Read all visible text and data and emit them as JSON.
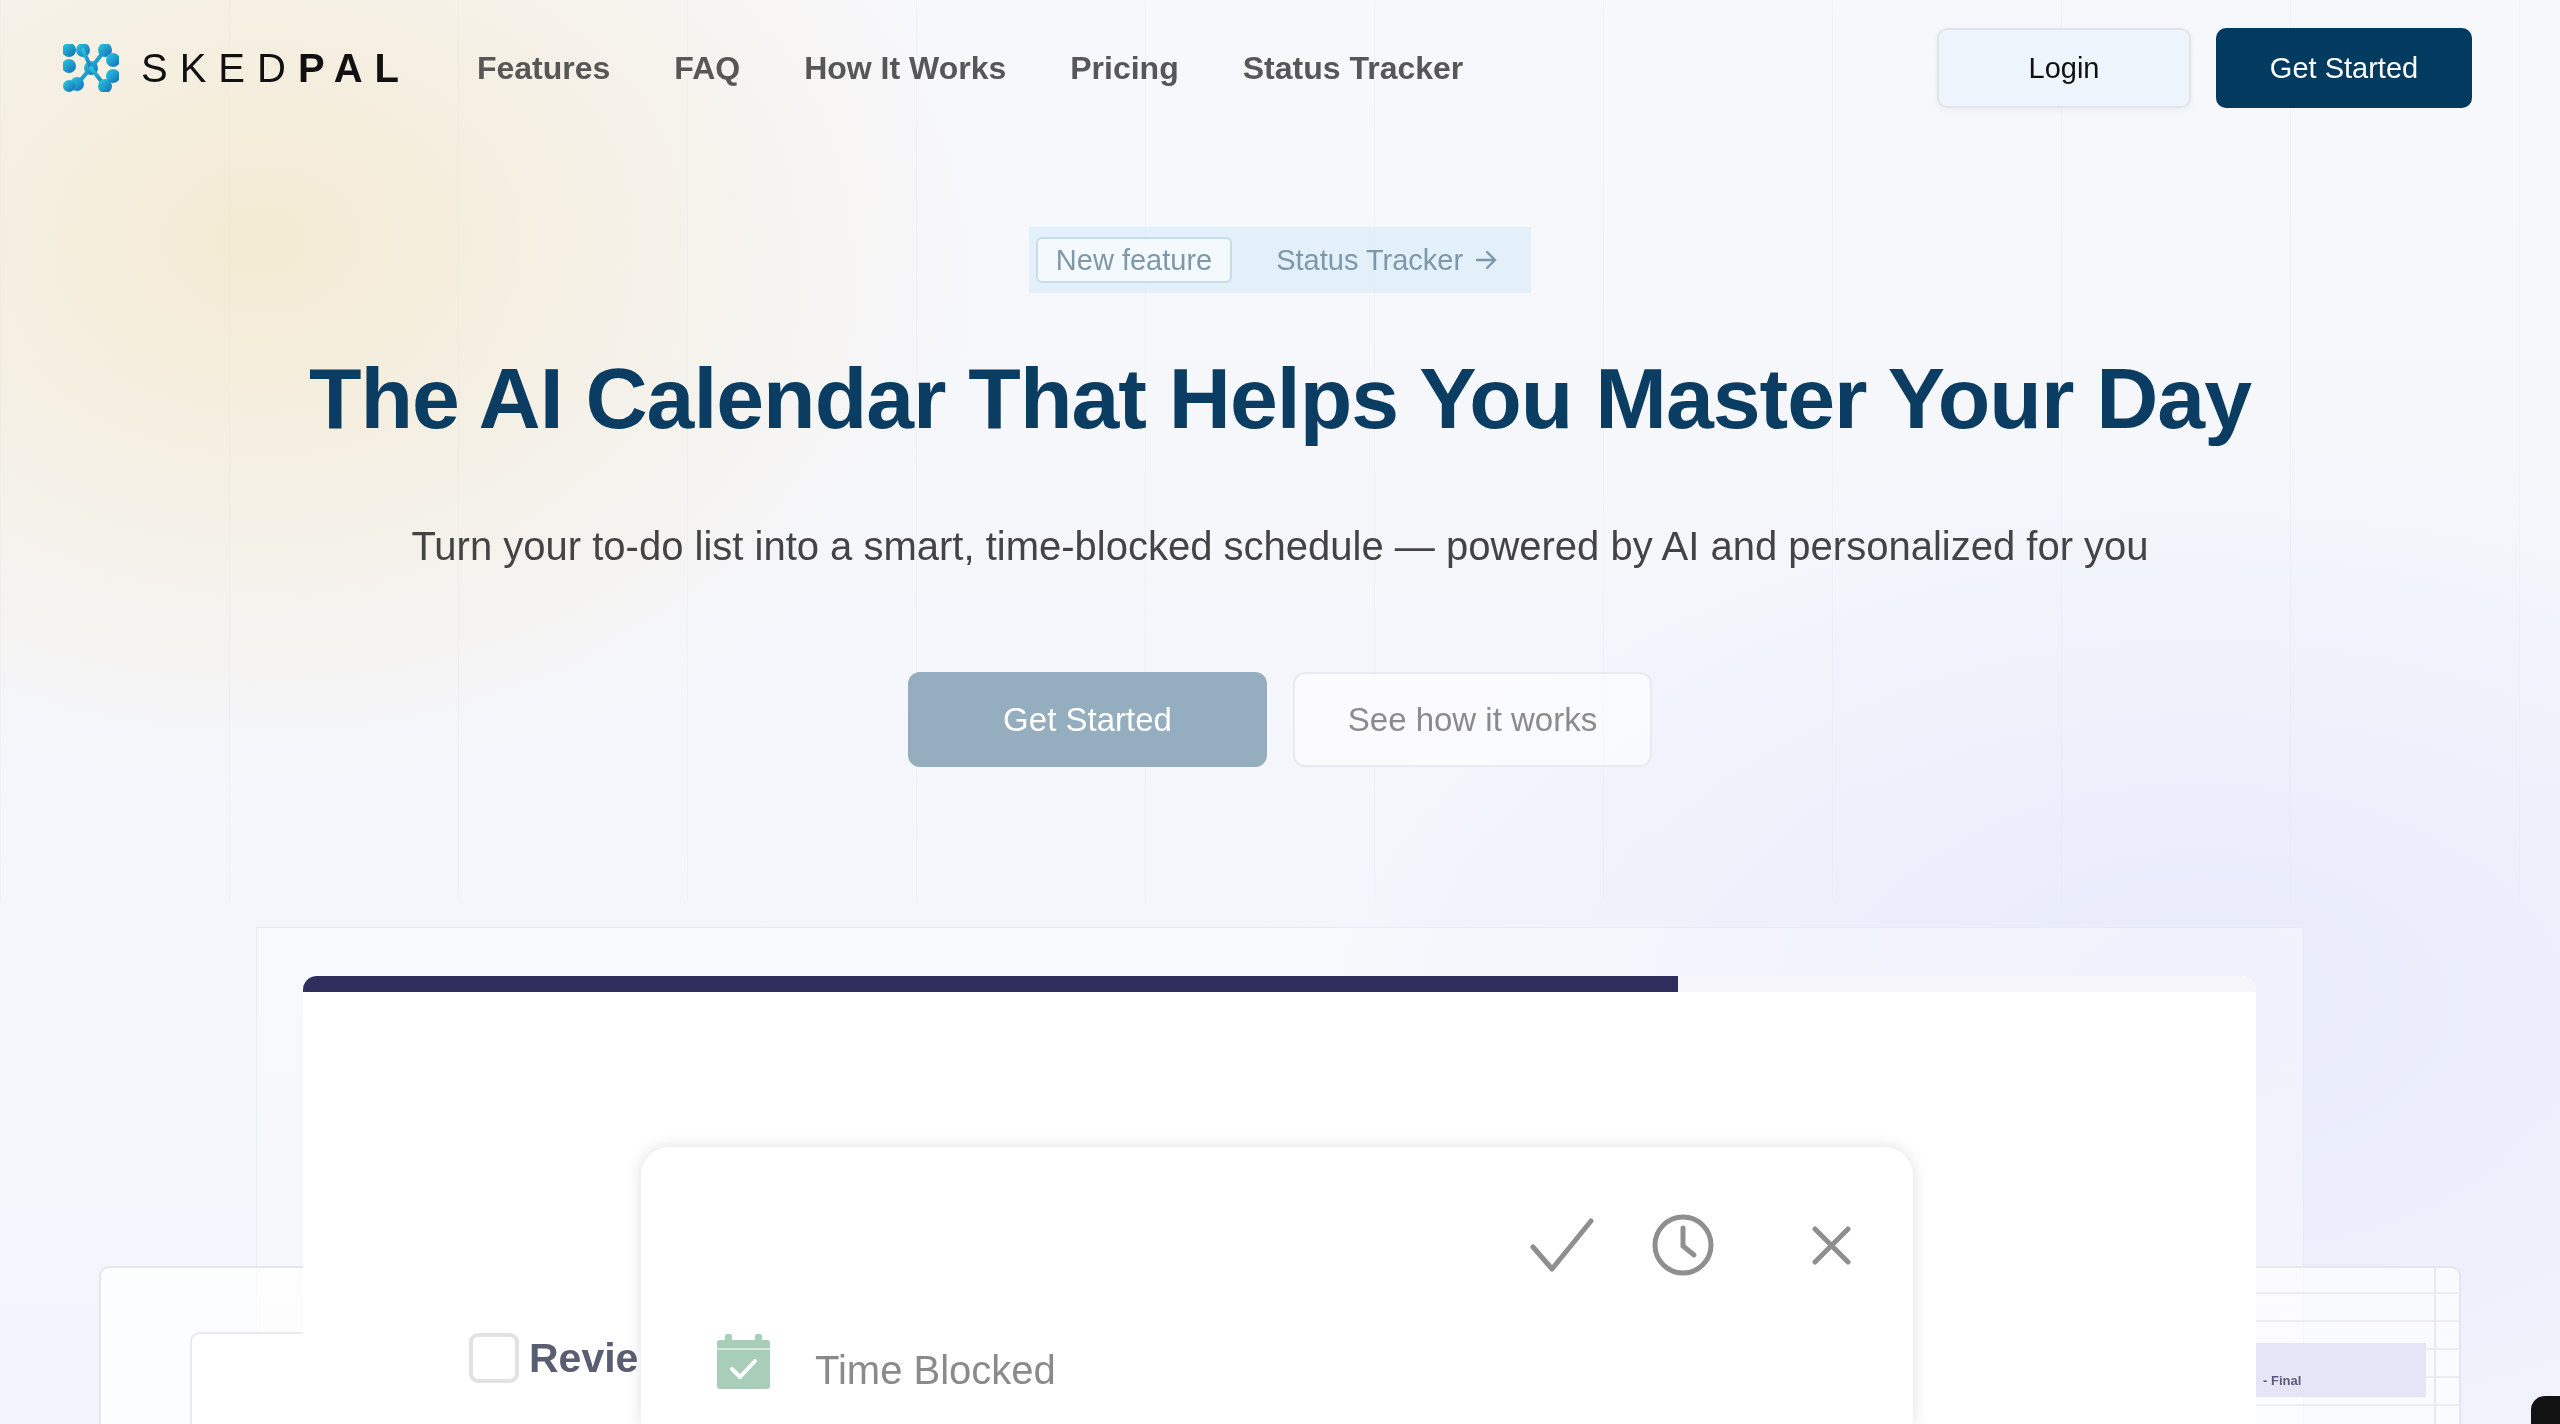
{
  "header": {
    "logo": "SKED**PAL**",
    "nav": [
      "Features",
      "FAQ",
      "How It Works",
      "Pricing",
      "Status Tracker"
    ],
    "buttons": [
      {
        "label": "Login",
        "kind": "secondary"
      },
      {
        "label": "Get Started",
        "kind": "primary"
      }
    ]
  },
  "hero": {
    "badge": {
      "tag": "New feature",
      "link": "Status Tracker"
    },
    "title": "The AI Calendar That Helps You Master Your Day",
    "subtitle": "Turn your to-do list into a smart, time-blocked schedule — powered by AI and personalized for you",
    "buttons": [
      {
        "label": "Get Started",
        "kind": "primary"
      },
      {
        "label": "See how it works",
        "kind": "secondary"
      }
    ]
  },
  "preview": {
    "progress": {
      "level": 0.704
    },
    "task": {
      "title": "Revie",
      "checked": false
    },
    "popup": {
      "status": "Time Blocked"
    },
    "side_event": "- Final"
  }
}
